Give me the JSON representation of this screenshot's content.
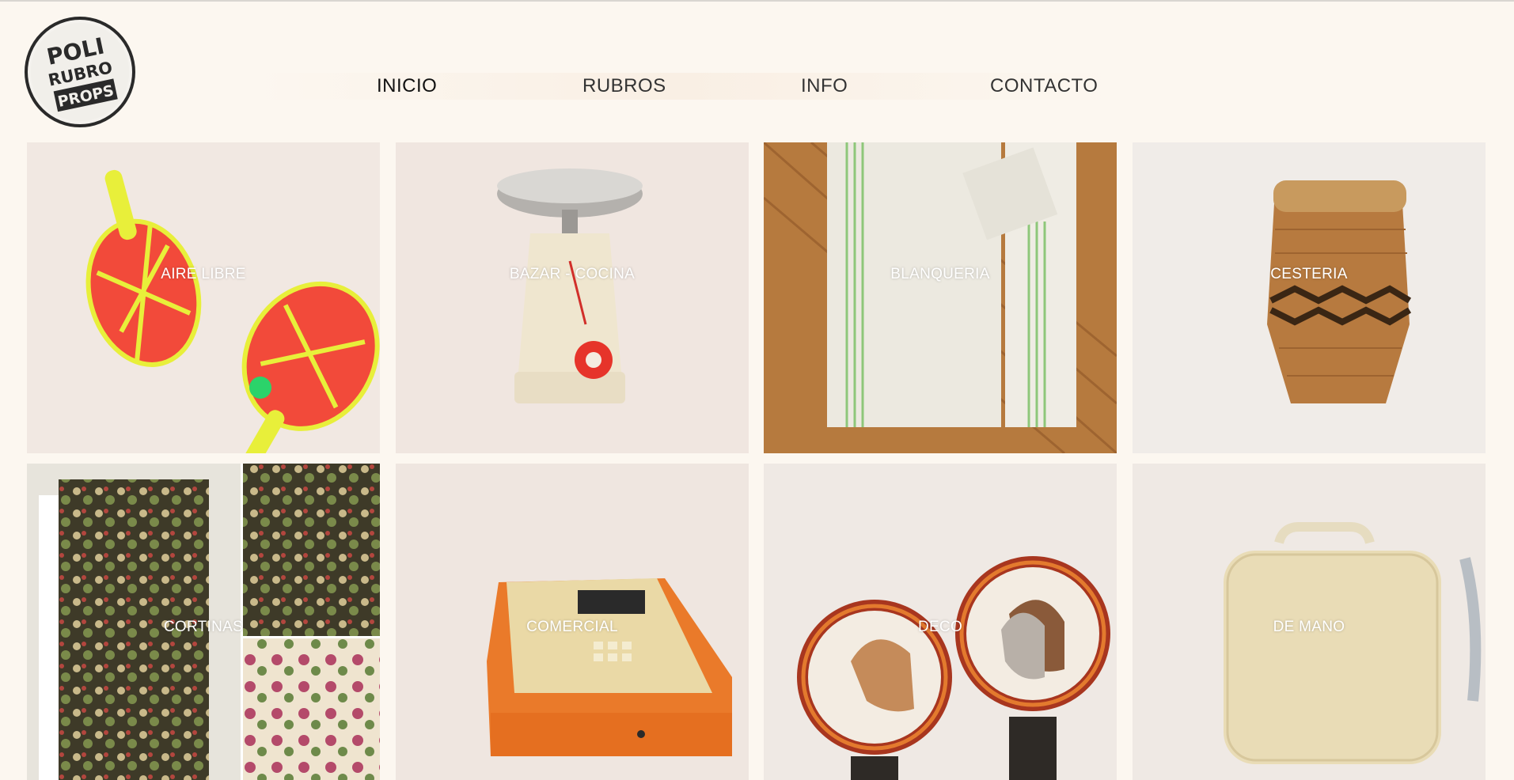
{
  "logo": {
    "line1": "POLI",
    "line2": "RUBRO",
    "line3": "PROPS"
  },
  "nav": {
    "items": [
      {
        "label": "INICIO",
        "active": true
      },
      {
        "label": "RUBROS",
        "active": false
      },
      {
        "label": "INFO",
        "active": false
      },
      {
        "label": "CONTACTO",
        "active": false
      }
    ]
  },
  "categories": [
    {
      "label": "AIRE LIBRE",
      "image": "beach-ball-paddles"
    },
    {
      "label": "BAZAR - COCINA",
      "image": "kitchen-scale"
    },
    {
      "label": "BLANQUERIA",
      "image": "towels"
    },
    {
      "label": "CESTERIA",
      "image": "wicker-basket"
    },
    {
      "label": "CORTINAS",
      "image": "floral-curtains"
    },
    {
      "label": "COMERCIAL",
      "image": "cash-register"
    },
    {
      "label": "DECO",
      "image": "horse-plates"
    },
    {
      "label": "DE MANO",
      "image": "vintage-suitcase"
    }
  ],
  "colors": {
    "background": "#fcf7f0",
    "text": "#333333",
    "label": "#ffffff"
  }
}
